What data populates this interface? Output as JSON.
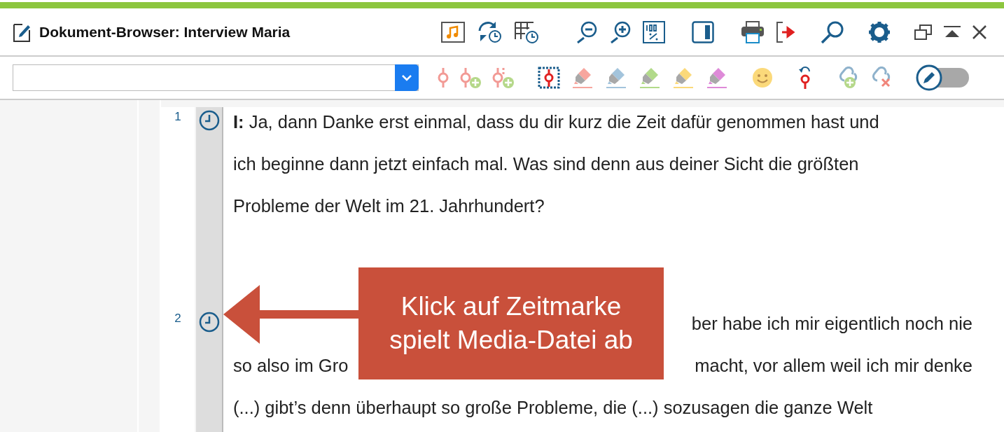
{
  "window": {
    "title": "Dokument-Browser: Interview Maria"
  },
  "edit_toggle": {
    "on": false
  },
  "paragraphs": [
    {
      "number": "1",
      "lines": [
        [
          "**I:** Ja, dann Danke erst einmal, dass du dir kurz die Zeit dafür genommen hast und"
        ],
        [
          "ich beginne dann jetzt einfach mal. Was sind denn aus deiner Sicht die größten"
        ],
        [
          "Probleme der Welt im 21. Jahrhundert?"
        ]
      ]
    },
    {
      "number": "2",
      "lines": [
        [
          "ber habe ich mir eigentlich noch nie"
        ],
        [
          "so also im Gro",
          "macht, vor allem weil ich mir denke"
        ],
        [
          "(...) gibt’s denn überhaupt so große Probleme, die (...) sozusagen die ganze Welt"
        ]
      ]
    }
  ],
  "callout": {
    "lines": [
      "Klick auf Zeitmarke",
      "spielt Media-Datei ab"
    ]
  }
}
